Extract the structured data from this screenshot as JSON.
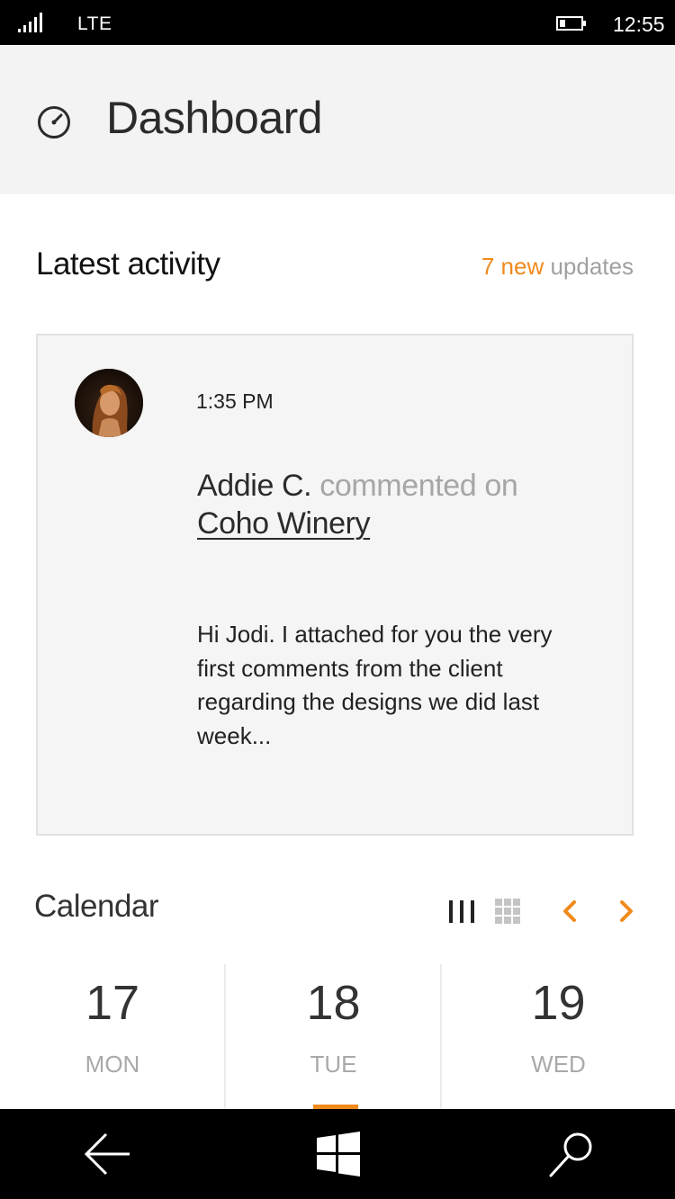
{
  "status_bar": {
    "network": "LTE",
    "time": "12:55"
  },
  "header": {
    "title": "Dashboard"
  },
  "activity": {
    "heading": "Latest activity",
    "updates_count": "7 new",
    "updates_label": "updates",
    "item": {
      "time": "1:35 PM",
      "author": "Addie C.",
      "action": "commented on",
      "target": "Coho Winery",
      "message": "Hi Jodi. I attached for you the very first comments from the client regarding the designs we did last week..."
    }
  },
  "calendar": {
    "heading": "Calendar",
    "days": [
      {
        "date": "17",
        "weekday": "MON"
      },
      {
        "date": "18",
        "weekday": "TUE"
      },
      {
        "date": "19",
        "weekday": "WED"
      }
    ],
    "selected_day_index": 1
  },
  "colors": {
    "accent": "#f08a1d",
    "header_bg": "#f3f3f3",
    "card_bg": "#f5f5f5",
    "muted_text": "#a6a6a6"
  },
  "icons": [
    "signal-icon",
    "battery-icon",
    "dashboard-gauge-icon",
    "columns-view-icon",
    "grid-view-icon",
    "chevron-left-icon",
    "chevron-right-icon",
    "back-arrow-icon",
    "windows-logo-icon",
    "search-icon"
  ]
}
